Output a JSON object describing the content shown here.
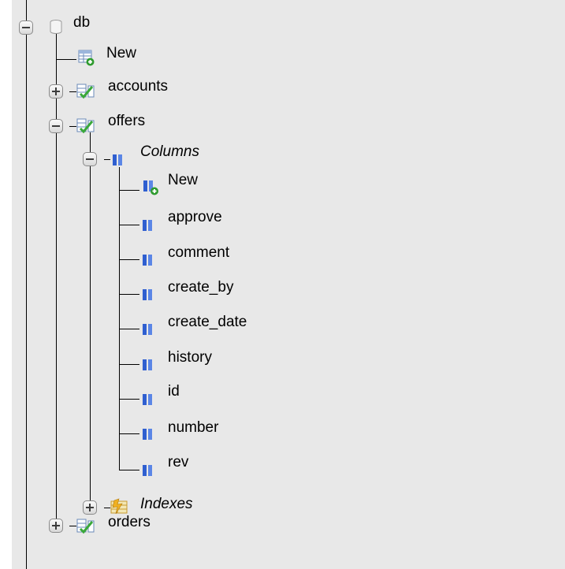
{
  "tree": {
    "db": {
      "label": "db",
      "icon": "database-icon",
      "expanded": true
    },
    "db_new": {
      "label": "New",
      "icon": "new-table-icon"
    },
    "tables": {
      "accounts": {
        "label": "accounts",
        "icon": "table-icon",
        "expanded": false
      },
      "offers": {
        "label": "offers",
        "icon": "table-icon",
        "expanded": true
      },
      "orders": {
        "label": "orders",
        "icon": "table-icon",
        "expanded": false
      }
    },
    "offers_columns": {
      "label": "Columns",
      "icon": "columns-icon",
      "expanded": true,
      "new": {
        "label": "New",
        "icon": "new-column-icon"
      },
      "items": [
        {
          "label": "approve"
        },
        {
          "label": "comment"
        },
        {
          "label": "create_by"
        },
        {
          "label": "create_date"
        },
        {
          "label": "history"
        },
        {
          "label": "id"
        },
        {
          "label": "number"
        },
        {
          "label": "rev"
        }
      ]
    },
    "offers_indexes": {
      "label": "Indexes",
      "icon": "indexes-icon",
      "expanded": false
    }
  },
  "colors": {
    "column_icon_blue": "#2f5fd0",
    "table_icon_green": "#3aa83a",
    "index_icon_yellow": "#f0b020"
  }
}
